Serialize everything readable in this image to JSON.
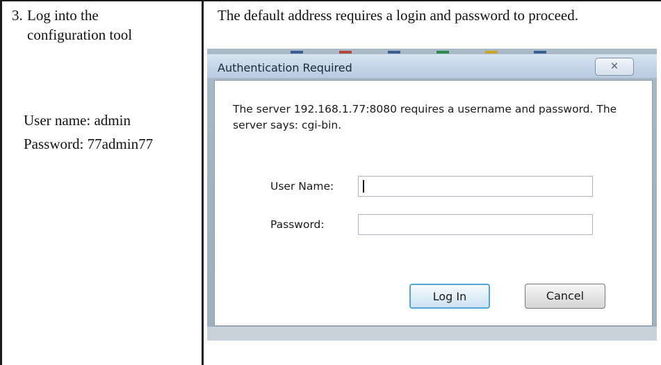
{
  "step": {
    "number": "3.",
    "title_line1": "Log into the",
    "title_line2": "configuration tool"
  },
  "credentials": {
    "user_line": "User name:  admin",
    "password_line": "Password:  77admin77"
  },
  "description": "The default address requires a login and password to proceed.",
  "dialog": {
    "title": "Authentication Required",
    "close_glyph": "✕",
    "message": "The server 192.168.1.77:8080 requires a username and password. The server says: cgi-bin.",
    "username_label": "User Name:",
    "username_value": "",
    "password_label": "Password:",
    "password_value": "",
    "login_button": "Log In",
    "cancel_button": "Cancel"
  }
}
